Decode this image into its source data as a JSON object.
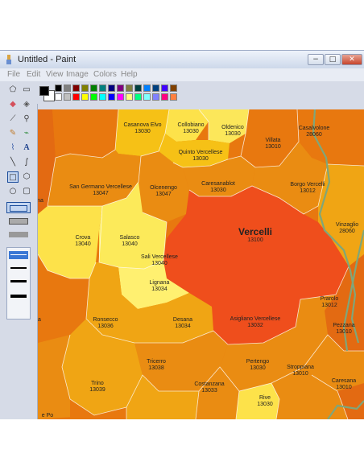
{
  "window": {
    "title": "Untitled - Paint"
  },
  "menu": [
    "File",
    "Edit",
    "View",
    "Image",
    "Colors",
    "Help"
  ],
  "window_buttons": {
    "minimize": "−",
    "maximize": "□",
    "close": "✕"
  },
  "palette": {
    "foreground": "#000000",
    "background": "#ffffff",
    "colors": [
      "#000000",
      "#808080",
      "#800000",
      "#808000",
      "#008000",
      "#008080",
      "#000080",
      "#800080",
      "#808040",
      "#004040",
      "#0080ff",
      "#004080",
      "#4000ff",
      "#804000",
      "#ffffff",
      "#c0c0c0",
      "#ff0000",
      "#ffff00",
      "#00ff00",
      "#00ffff",
      "#0000ff",
      "#ff00ff",
      "#ffff80",
      "#00ff80",
      "#80ffff",
      "#8080ff",
      "#ff0080",
      "#ff8040"
    ]
  },
  "map": {
    "colors": {
      "base": "#e8780f",
      "dark_orange": "#e36a12",
      "mid_orange": "#ea8c12",
      "light_orange": "#f0a514",
      "yellow": "#f6c116",
      "pale_yellow": "#fde24a",
      "bright_yellow": "#fcea5a",
      "red": "#ef4e1c",
      "border_green": "#7fa67a"
    },
    "regions": [
      {
        "name": "Casanova Elvo",
        "code": "13030"
      },
      {
        "name": "Collobiano",
        "code": "13030"
      },
      {
        "name": "Oldenico",
        "code": "13030"
      },
      {
        "name": "Quinto Vercellese",
        "code": "13030"
      },
      {
        "name": "Villata",
        "code": "13010"
      },
      {
        "name": "Casalvolone",
        "code": "28060"
      },
      {
        "name": "San Germano Vercellese",
        "code": "13047"
      },
      {
        "name": "Olcenengo",
        "code": "13047"
      },
      {
        "name": "Caresanablot",
        "code": "13030"
      },
      {
        "name": "Borgo Vercelli",
        "code": "13012"
      },
      {
        "name": "Vercelli",
        "code": "13100"
      },
      {
        "name": "Vinzaglio",
        "code": "28060"
      },
      {
        "name": "Crova",
        "code": "13040"
      },
      {
        "name": "Salasco",
        "code": "13040"
      },
      {
        "name": "Sali Vercellese",
        "code": "13040"
      },
      {
        "name": "Lignana",
        "code": "13034"
      },
      {
        "name": "Prarolo",
        "code": "13012"
      },
      {
        "name": "Ronsecco",
        "code": "13036"
      },
      {
        "name": "Desana",
        "code": "13034"
      },
      {
        "name": "Asigliano Vercellese",
        "code": "13032"
      },
      {
        "name": "Pezzana",
        "code": "13010"
      },
      {
        "name": "Tricerro",
        "code": "13038"
      },
      {
        "name": "Pertengo",
        "code": "13030"
      },
      {
        "name": "Stroppiana",
        "code": "13010"
      },
      {
        "name": "Trino",
        "code": "13039"
      },
      {
        "name": "Costanzana",
        "code": "13033"
      },
      {
        "name": "Rive",
        "code": "13030"
      },
      {
        "name": "Caresana",
        "code": "13010"
      }
    ],
    "edge_fragments": [
      "na",
      "a",
      "e Po"
    ]
  }
}
